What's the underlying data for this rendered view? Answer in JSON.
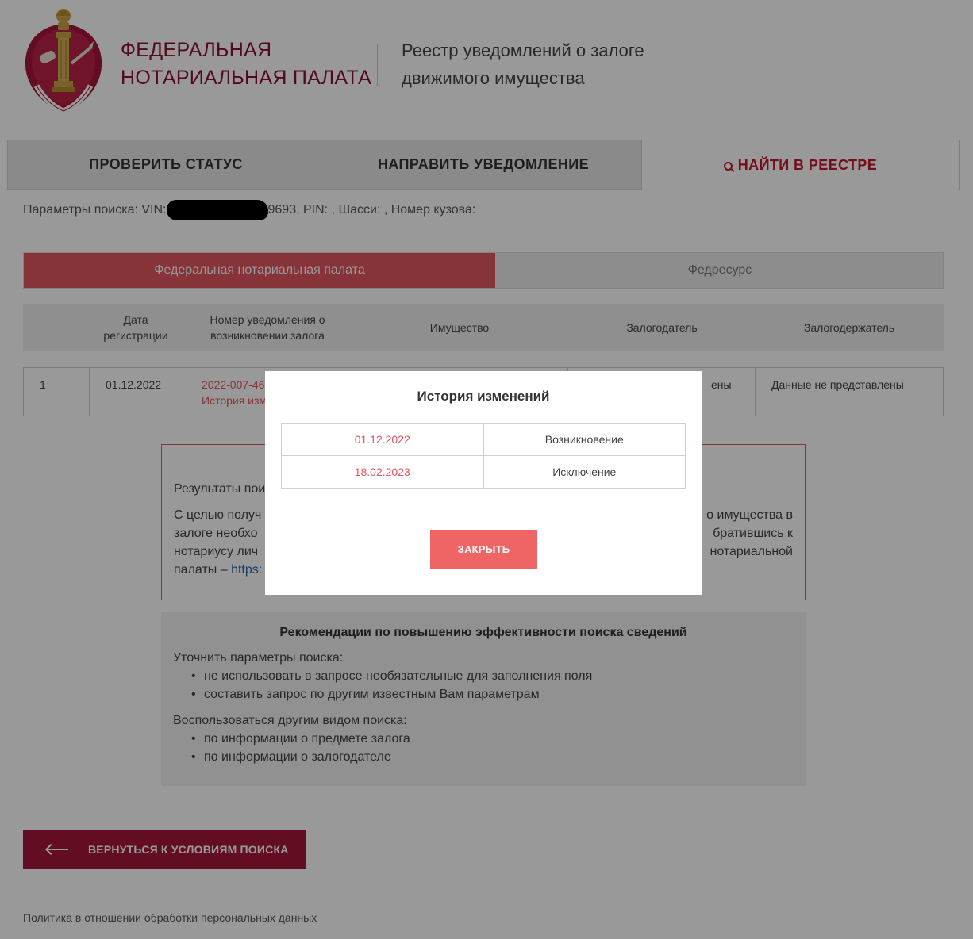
{
  "header": {
    "org_line1": "ФЕДЕРАЛЬНАЯ",
    "org_line2": "НОТАРИАЛЬНАЯ ПАЛАТА",
    "registry_line1": "Реестр уведомлений о залоге",
    "registry_line2": "движимого имущества",
    "emblem": {
      "icon": "notary-emblem-icon",
      "colors": {
        "red": "#a5163a",
        "gold": "#c8a24a"
      }
    }
  },
  "main_tabs": {
    "status": "ПРОВЕРИТЬ СТАТУС",
    "send": "НАПРАВИТЬ УВЕДОМЛЕНИЕ",
    "find": "НАЙТИ В РЕЕСТРЕ",
    "active": "find"
  },
  "search_params": {
    "prefix": "Параметры поиска: VIN:",
    "suffix": "9693, PIN: , Шасси: , Номер кузова:"
  },
  "source_tabs": {
    "fnp": "Федеральная нотариальная палата",
    "fedresurs": "Федресурс",
    "active": "fnp"
  },
  "table": {
    "headers": {
      "date": "Дата регистрации",
      "number": "Номер уведомления о возникновении залога",
      "property": "Имущество",
      "pledgor": "Залогодатель",
      "pledgee": "Залогодержатель"
    },
    "rows": [
      {
        "index": "1",
        "date": "01.12.2022",
        "number_visible": "2022-007-46",
        "history_visible": "История изм",
        "pledgor_visible": "ены",
        "pledgee": "Данные не представлены"
      }
    ]
  },
  "notice": {
    "title_visible": "Результаты пои",
    "line1_left": "С целью получ",
    "line1_right": "о имущества в",
    "line2_left": "залоге необхо",
    "line2_right": "братившись к",
    "line3_left": "нотариусу лич",
    "line3_right": "нотариальной",
    "line4_prefix": "палаты – ",
    "line4_link": "https:"
  },
  "recommendations": {
    "title": "Рекомендации по повышению эффективности поиска сведений",
    "group1_title": "Уточнить параметры поиска:",
    "group1_items": [
      "не использовать в запросе необязательные для заполнения поля",
      "составить запрос по другим известным Вам параметрам"
    ],
    "group2_title": "Воспользоваться другим видом поиска:",
    "group2_items": [
      "по информации о предмете залога",
      "по информации о залогодателе"
    ]
  },
  "back_button": "ВЕРНУТЬСЯ К УСЛОВИЯМ ПОИСКА",
  "footer_link": "Политика в отношении обработки персональных данных",
  "modal": {
    "title": "История изменений",
    "history": [
      {
        "date": "01.12.2022",
        "event": "Возникновение"
      },
      {
        "date": "18.02.2023",
        "event": "Исключение"
      }
    ],
    "close_label": "ЗАКРЫТЬ"
  },
  "colors": {
    "brand": "#8b0f2d",
    "accent": "#e0565f",
    "button": "#a5163a",
    "close_button": "#ef6465"
  }
}
